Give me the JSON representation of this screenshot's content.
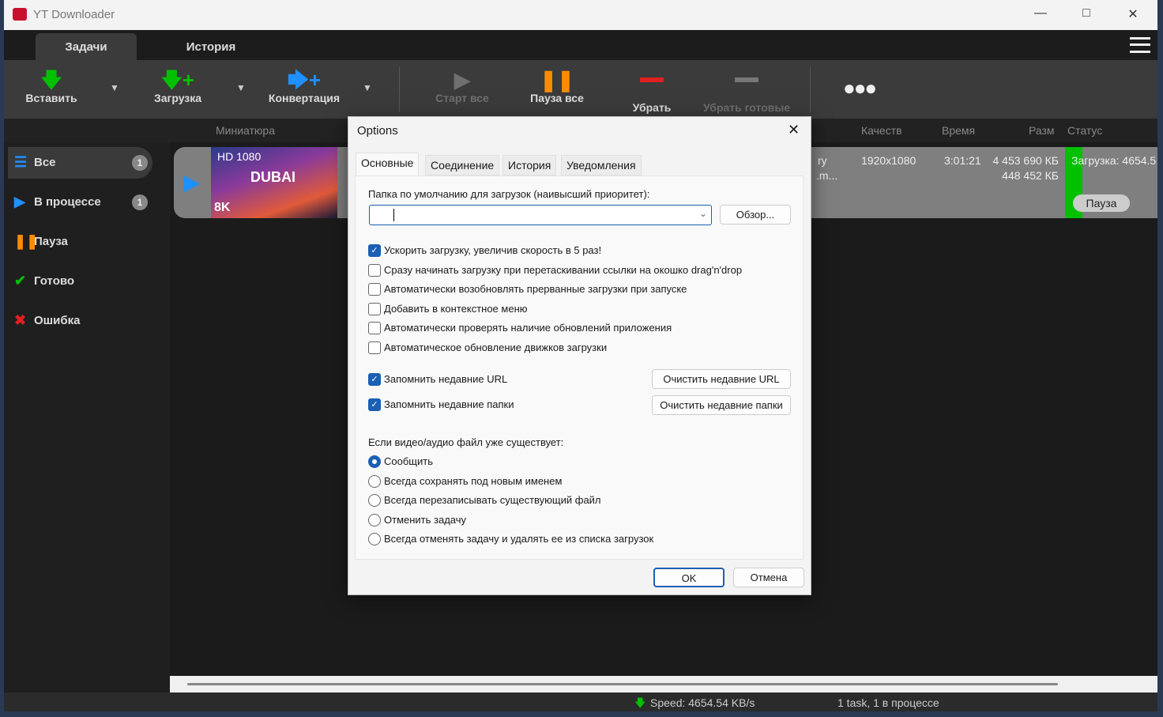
{
  "window": {
    "title": "YT Downloader"
  },
  "tabs": [
    "Задачи",
    "История"
  ],
  "toolbar": {
    "paste": "Вставить",
    "download": "Загрузка",
    "convert": "Конвертация",
    "start_all": "Старт все",
    "pause_all": "Пауза все",
    "remove": "Убрать",
    "remove_done": "Убрать готовые"
  },
  "columns": {
    "thumb": "Миниатюра",
    "quality": "Качеств",
    "time": "Время",
    "size": "Разм",
    "status": "Статус"
  },
  "sidebar": [
    {
      "label": "Все",
      "count": "1"
    },
    {
      "label": "В процессе",
      "count": "1"
    },
    {
      "label": "Пауза"
    },
    {
      "label": "Готово"
    },
    {
      "label": "Ошибка"
    }
  ],
  "task": {
    "thumb_badge": "HD 1080",
    "thumb_title": "DUBAI",
    "thumb_8k": "8K",
    "title_frag1": "ry",
    "title_frag2": ".m...",
    "quality": "1920x1080",
    "time": "3:01:21",
    "size1": "4 453 690 КБ",
    "size2": "448 452 КБ",
    "status": "Загрузка: 4654.5",
    "pause": "Пауза"
  },
  "statusbar": {
    "speed": "Speed: 4654.54 KB/s",
    "tasks": "1 task, 1 в процессе"
  },
  "dialog": {
    "title": "Options",
    "tabs": [
      "Основные",
      "Соединение",
      "История",
      "Уведомления"
    ],
    "folder_label": "Папка по умолчанию для загрузок (наивысший приоритет):",
    "folder_value": "",
    "browse": "Обзор...",
    "checks": [
      {
        "label": "Ускорить загрузку, увеличив скорость в 5 раз!",
        "checked": true
      },
      {
        "label": "Сразу начинать загрузку при перетаскивании ссылки на окошко drag'n'drop",
        "checked": false
      },
      {
        "label": "Автоматически возобновлять прерванные загрузки при запуске",
        "checked": false
      },
      {
        "label": "Добавить в контекстное меню",
        "checked": false
      },
      {
        "label": "Автоматически проверять наличие обновлений приложения",
        "checked": false
      },
      {
        "label": "Автоматическое обновление движков загрузки",
        "checked": false
      }
    ],
    "remember_url": "Запомнить недавние URL",
    "clear_url": "Очистить недавние URL",
    "remember_folders": "Запомнить недавние папки",
    "clear_folders": "Очистить недавние папки",
    "exists_label": "Если видео/аудио файл уже существует:",
    "radios": [
      "Сообщить",
      "Всегда сохранять под новым именем",
      "Всегда перезаписывать существующий файл",
      "Отменить задачу",
      "Всегда отменять задачу и удалять ее из списка загрузок"
    ],
    "ok": "OK",
    "cancel": "Отмена"
  },
  "colors": {
    "green": "#00c000",
    "blue": "#1e90ff",
    "orange": "#ff8c00",
    "red": "#e02020",
    "accent": "#1a5fb4"
  }
}
